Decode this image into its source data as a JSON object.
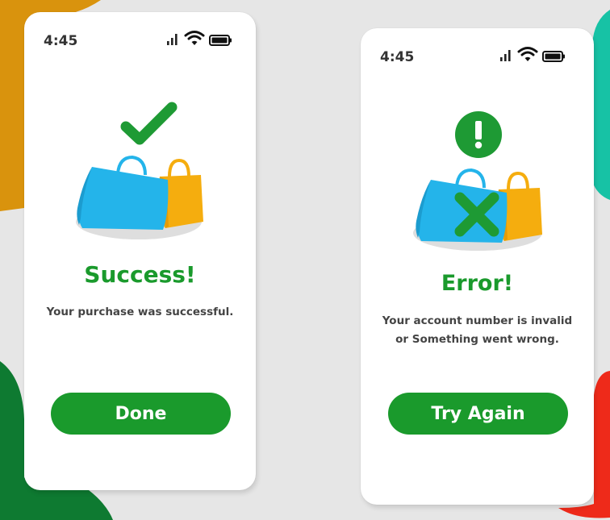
{
  "colors": {
    "accent": "#1a9a2c",
    "bag_blue": "#24b4ea",
    "bag_yellow": "#f5ad0e",
    "error_mark": "#1e9a34",
    "bg_orange": "#d9930d",
    "bg_teal": "#17c2a5",
    "bg_green": "#0e7a31",
    "bg_red": "#ee2a1a"
  },
  "success_screen": {
    "status_time": "4:45",
    "icon": "checkmark-icon",
    "title": "Success!",
    "message": "Your purchase was successful.",
    "button_label": "Done"
  },
  "error_screen": {
    "status_time": "4:45",
    "icon": "exclamation-icon",
    "title": "Error!",
    "message_line1": "Your account  number is invalid",
    "message_line2": "or Something went wrong.",
    "button_label": "Try Again"
  }
}
